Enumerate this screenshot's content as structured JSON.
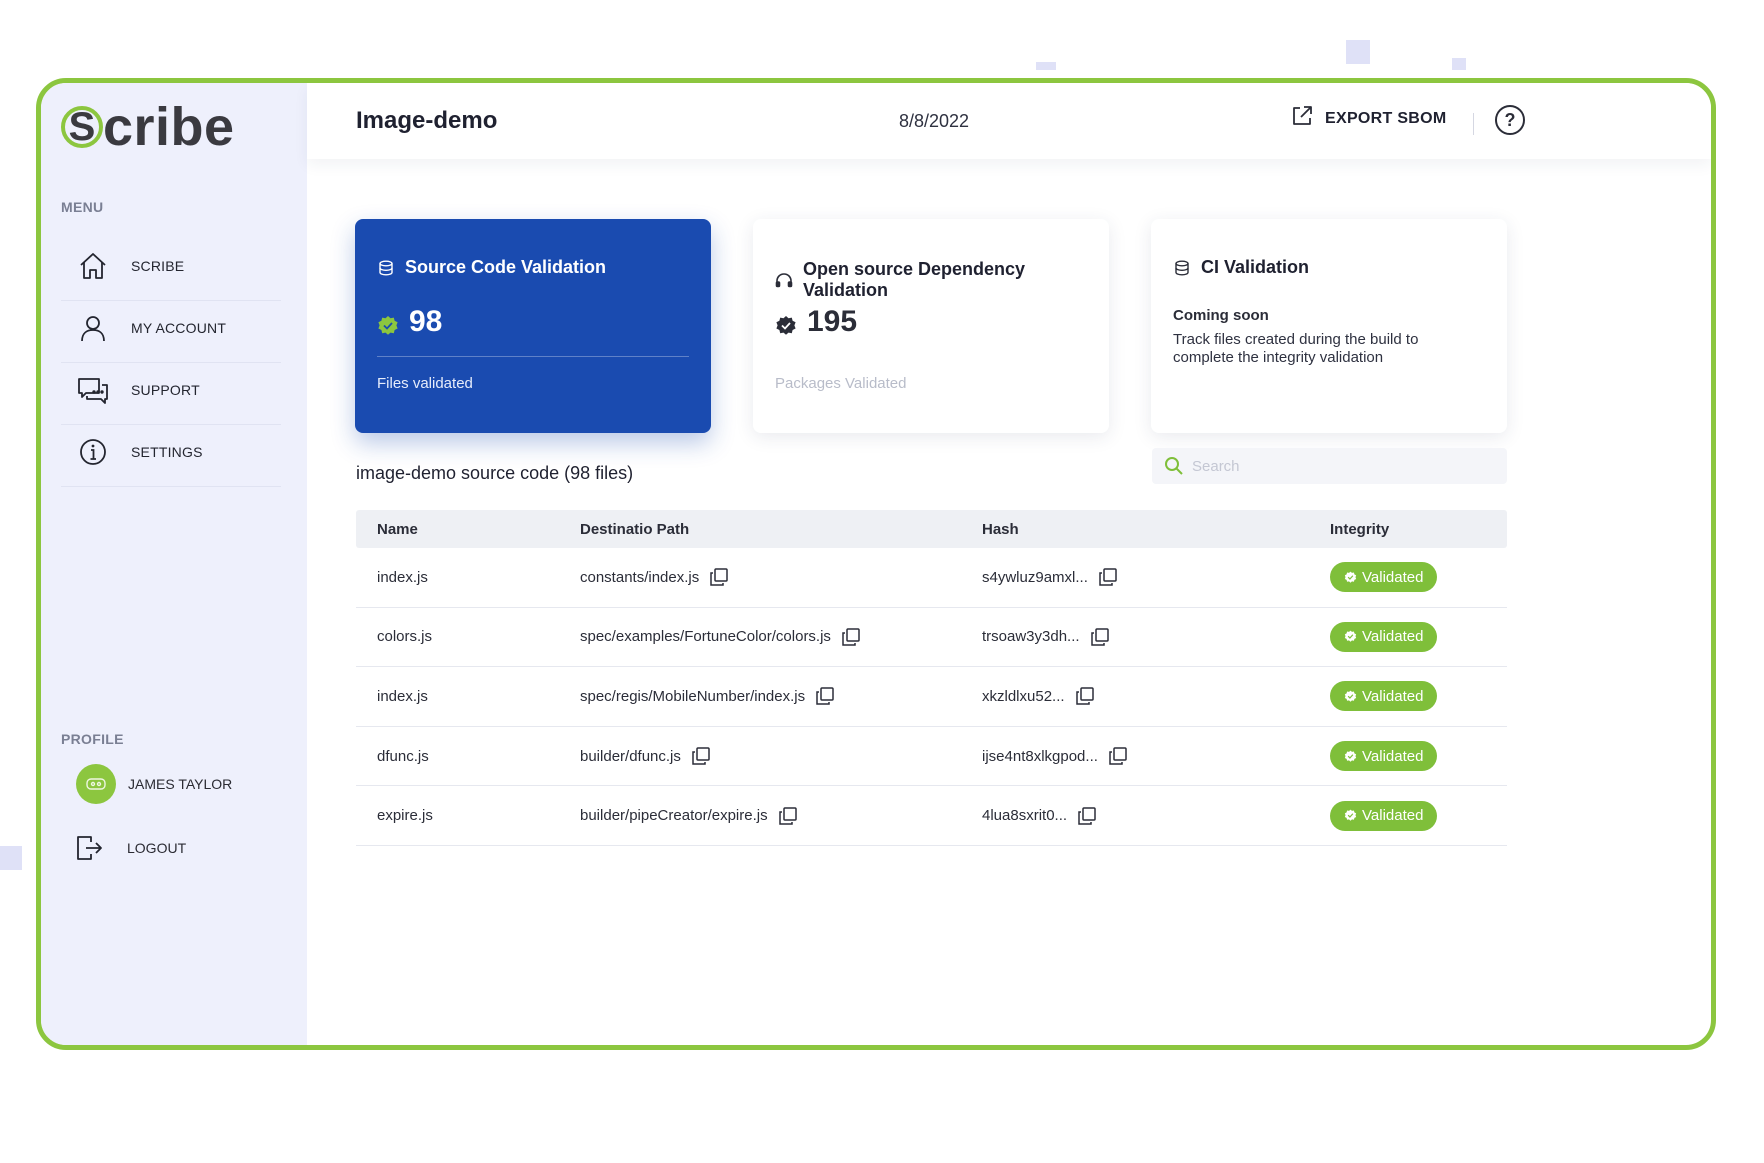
{
  "app": {
    "logo_letter": "S",
    "logo_rest": "cribe"
  },
  "sidebar": {
    "menu_label": "MENU",
    "items": [
      {
        "label": "SCRIBE",
        "icon": "home-icon"
      },
      {
        "label": "MY ACCOUNT",
        "icon": "user-icon"
      },
      {
        "label": "SUPPORT",
        "icon": "chat-icon"
      },
      {
        "label": "SETTINGS",
        "icon": "info-icon"
      }
    ],
    "profile_label": "PROFILE",
    "user_name": "JAMES TAYLOR",
    "logout_label": "LOGOUT"
  },
  "header": {
    "title": "Image-demo",
    "date": "8/8/2022",
    "export_label": "EXPORT SBOM",
    "help_label": "?"
  },
  "cards": [
    {
      "title": "Source Code Validation",
      "value": "98",
      "subtitle": "Files validated",
      "active": true
    },
    {
      "title": "Open source Dependency Validation",
      "value": "195",
      "subtitle": "Packages Validated",
      "active": false
    },
    {
      "title": "CI Validation",
      "heading": "Coming soon",
      "body": "Track files created during the build to complete the integrity validation",
      "active": false
    }
  ],
  "list": {
    "title": "image-demo source code (98 files)",
    "search_placeholder": "Search"
  },
  "table": {
    "columns": [
      "Name",
      "Destinatio Path",
      "Hash",
      "Integrity"
    ],
    "rows": [
      {
        "name": "index.js",
        "path": "constants/index.js",
        "hash": "s4ywluz9amxl...",
        "integrity": "Validated"
      },
      {
        "name": "colors.js",
        "path": "spec/examples/FortuneColor/colors.js",
        "hash": "trsoaw3y3dh...",
        "integrity": "Validated"
      },
      {
        "name": "index.js",
        "path": "spec/regis/MobileNumber/index.js",
        "hash": "xkzldlxu52...",
        "integrity": "Validated"
      },
      {
        "name": "dfunc.js",
        "path": "builder/dfunc.js",
        "hash": "ijse4nt8xlkgpod...",
        "integrity": "Validated"
      },
      {
        "name": "expire.js",
        "path": "builder/pipeCreator/expire.js",
        "hash": "4lua8sxrit0...",
        "integrity": "Validated"
      }
    ]
  },
  "colors": {
    "accent_green": "#8cc63f",
    "active_blue": "#1a4bb0",
    "badge_green": "#7fbf3a",
    "sidebar_bg": "#eef0fc"
  }
}
